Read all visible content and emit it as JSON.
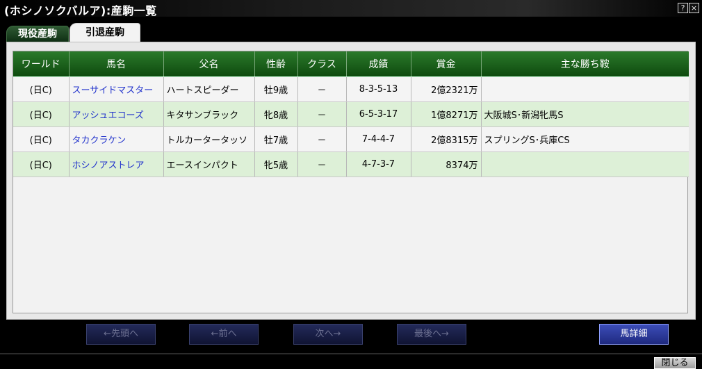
{
  "window": {
    "title": "(ホシノソクバルア):産駒一覧",
    "help_label": "?",
    "close_label": "×"
  },
  "tabs": [
    {
      "label": "現役産駒",
      "active": false
    },
    {
      "label": "引退産駒",
      "active": true
    }
  ],
  "table": {
    "headers": [
      "ワールド",
      "馬名",
      "父名",
      "性齢",
      "クラス",
      "成績",
      "賞金",
      "主な勝ち鞍"
    ],
    "rows": [
      [
        "(日C)",
        "スーサイドマスター",
        "ハートスピーダー",
        "牡9歳",
        "－",
        "8-3-5-13",
        "2億2321万",
        ""
      ],
      [
        "(日C)",
        "アッシュエコーズ",
        "キタサンブラック",
        "牝8歳",
        "－",
        "6-5-3-17",
        "1億8271万",
        "大阪城S･新潟牝馬S"
      ],
      [
        "(日C)",
        "タカクラケン",
        "トルカータータッソ",
        "牡7歳",
        "－",
        "7-4-4-7",
        "2億8315万",
        "スプリングS･兵庫CS"
      ],
      [
        "(日C)",
        "ホシノアストレア",
        "エースインパクト",
        "牝5歳",
        "－",
        "4-7-3-7",
        "8374万",
        ""
      ]
    ]
  },
  "nav": {
    "first_label": "←先頭へ",
    "prev_label": "←前へ",
    "next_label": "次へ→",
    "last_label": "最後へ→",
    "detail_label": "馬詳細",
    "close_label": "閉じる"
  },
  "colors": {
    "header_green": "#1e6b1e",
    "row_alt": "#ddf0d7",
    "link_blue": "#2233cc",
    "button_blue": "#2f3ea0"
  }
}
